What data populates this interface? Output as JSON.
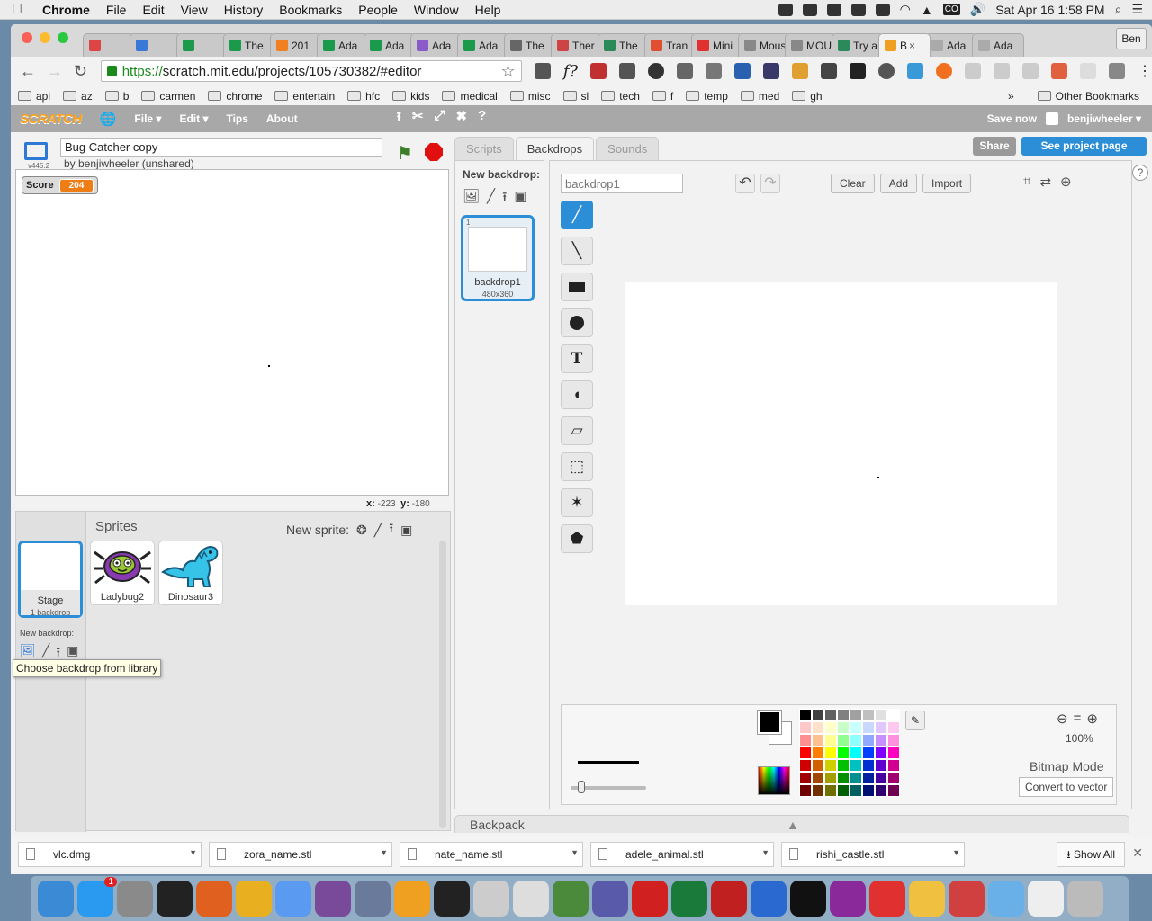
{
  "menubar": {
    "app": "Chrome",
    "items": [
      "File",
      "Edit",
      "View",
      "History",
      "Bookmarks",
      "People",
      "Window",
      "Help"
    ],
    "clock": "Sat Apr 16  1:58 PM",
    "co_badge": "CO"
  },
  "browser": {
    "tabs": [
      {
        "label": "",
        "color": "#d44"
      },
      {
        "label": "",
        "color": "#3a78d6"
      },
      {
        "label": "",
        "color": "#1a9a4a"
      },
      {
        "label": "The",
        "color": "#1a9a4a"
      },
      {
        "label": "201",
        "color": "#f08020"
      },
      {
        "label": "Ada",
        "color": "#1a9a4a"
      },
      {
        "label": "Ada",
        "color": "#1a9a4a"
      },
      {
        "label": "Ada",
        "color": "#8a5ac8"
      },
      {
        "label": "Ada",
        "color": "#1a9a4a"
      },
      {
        "label": "The",
        "color": "#666"
      },
      {
        "label": "Ther",
        "color": "#c44"
      },
      {
        "label": "The",
        "color": "#2a8a5a"
      },
      {
        "label": "Tran",
        "color": "#e05030"
      },
      {
        "label": "Mini",
        "color": "#e03030"
      },
      {
        "label": "Mous",
        "color": "#888"
      },
      {
        "label": "MOU",
        "color": "#888"
      },
      {
        "label": "Try a",
        "color": "#2a8a5a"
      },
      {
        "label": "B",
        "color": "#f0a020"
      },
      {
        "label": "Ada",
        "color": "#aaa"
      },
      {
        "label": "Ada",
        "color": "#aaa"
      }
    ],
    "profile": "Ben",
    "url_scheme": "https://",
    "url_rest": "scratch.mit.edu/projects/105730382/#editor",
    "bookmarks": [
      "api",
      "az",
      "b",
      "carmen",
      "chrome",
      "entertain",
      "hfc",
      "kids",
      "medical",
      "misc",
      "sl",
      "tech",
      "f",
      "temp",
      "med",
      "gh"
    ],
    "other_bookmarks": "Other Bookmarks",
    "chevron": "»"
  },
  "scratch_bar": {
    "logo": "SCRATCH",
    "menus": [
      "File",
      "Edit",
      "Tips",
      "About"
    ],
    "save_now": "Save now",
    "username": "benjiwheeler",
    "share": "Share",
    "see_project": "See project page"
  },
  "stage": {
    "title": "Bug Catcher copy",
    "author": "by benjiwheeler (unshared)",
    "version": "v445.2",
    "monitor_label": "Score",
    "monitor_value": "204",
    "x_label": "x:",
    "x_value": "-223",
    "y_label": "y:",
    "y_value": "-180"
  },
  "sprites_pane": {
    "header": "Sprites",
    "new_sprite_label": "New sprite:",
    "stage_label": "Stage",
    "stage_sub": "1 backdrop",
    "new_backdrop_label": "New backdrop:",
    "tooltip": "Choose backdrop from library",
    "sprites": [
      "Ladybug2",
      "Dinosaur3"
    ]
  },
  "tabs": [
    "Scripts",
    "Backdrops",
    "Sounds"
  ],
  "active_tab": "Backdrops",
  "costumes": {
    "new_backdrop_label": "New backdrop:",
    "thumb_number": "1",
    "thumb_name": "backdrop1",
    "thumb_size": "480x360"
  },
  "editor": {
    "costume_name_placeholder": "backdrop1",
    "clear": "Clear",
    "add": "Add",
    "import": "Import",
    "zoom": "100%",
    "mode": "Bitmap Mode",
    "convert": "Convert to vector",
    "backpack": "Backpack"
  },
  "palette": [
    "#000000",
    "#404040",
    "#606060",
    "#808080",
    "#a0a0a0",
    "#c0c0c0",
    "#e0e0e0",
    "#ffffff",
    "#ffc8c8",
    "#ffe0c8",
    "#ffffc8",
    "#c8ffc8",
    "#c8ffff",
    "#c8d8ff",
    "#e0c8ff",
    "#ffc8f0",
    "#ff9090",
    "#ffc090",
    "#ffff90",
    "#90ff90",
    "#90ffff",
    "#90a8ff",
    "#c890ff",
    "#ff90e0",
    "#ff0000",
    "#ff8000",
    "#ffff00",
    "#00ff00",
    "#00ffff",
    "#0040ff",
    "#8000ff",
    "#ff00c0",
    "#d00000",
    "#d06000",
    "#d0d000",
    "#00c000",
    "#00c0c0",
    "#0030d0",
    "#6000d0",
    "#d00090",
    "#a00000",
    "#a04800",
    "#a0a000",
    "#009000",
    "#009090",
    "#0020a0",
    "#4800a0",
    "#a00070",
    "#700000",
    "#703000",
    "#707000",
    "#006000",
    "#006060",
    "#001070",
    "#300070",
    "#700050"
  ],
  "downloads": [
    "vlc.dmg",
    "zora_name.stl",
    "nate_name.stl",
    "adele_animal.stl",
    "rishi_castle.stl"
  ],
  "show_all": "Show All",
  "dock_colors": [
    "#3a8ad6",
    "#2a9af0",
    "#8a8a8a",
    "#222",
    "#e06020",
    "#e8b020",
    "#5a9af0",
    "#7a4a9a",
    "#6a7a9a",
    "#f0a020",
    "#222",
    "#ccc",
    "#ddd",
    "#4a8a3a",
    "#5a5aaa",
    "#d02020",
    "#1a7a3a",
    "#c02020",
    "#2a6ad0",
    "#111",
    "#8a2a9a",
    "#e03030",
    "#f0c040",
    "#d04040",
    "#6ab0e8",
    "#eee",
    "#bbb"
  ],
  "badge_count": "1"
}
